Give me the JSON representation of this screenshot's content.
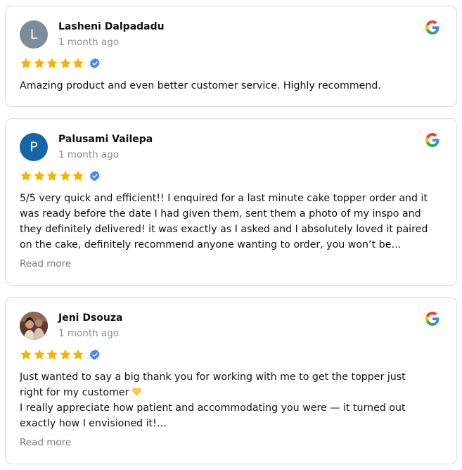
{
  "reviews": [
    {
      "avatar_letter": "L",
      "avatar_color": "#7a8d99",
      "name": "Lasheni Dalpadadu",
      "time": "1 month ago",
      "rating": 5,
      "verified": true,
      "text_lines": [
        "Amazing product and even better customer service. Highly recommend."
      ]
    },
    {
      "avatar_letter": "P",
      "avatar_color": "#1565a8",
      "name": "Palusami Vailepa",
      "time": "1 month ago",
      "rating": 5,
      "verified": true,
      "text_lines": [
        "5/5 very quick and efficient!! I enquired for a last minute cake topper order and it",
        "was ready before the date I had given them, sent them a photo of my inspo and",
        "they definitely delivered! it was exactly as I asked and I absolutely loved it paired",
        "on the cake, definitely recommend anyone wanting to order, you won’t be…"
      ],
      "read_more": "Read more"
    },
    {
      "avatar_letter": "",
      "avatar_color": "#6b4a3a",
      "name": "Jeni Dsouza",
      "time": "1 month ago",
      "rating": 5,
      "verified": true,
      "text_lines": [
        "Just wanted to say a big thank you for working with me to get the topper just",
        "right for my customer",
        "I really appreciate how patient and accommodating you were — it turned out",
        "exactly how I envisioned it!…"
      ],
      "read_more": "Read more"
    }
  ],
  "colors": {
    "star": "#f5b400",
    "verified": "#4285f4",
    "heart": "#f7c948"
  }
}
